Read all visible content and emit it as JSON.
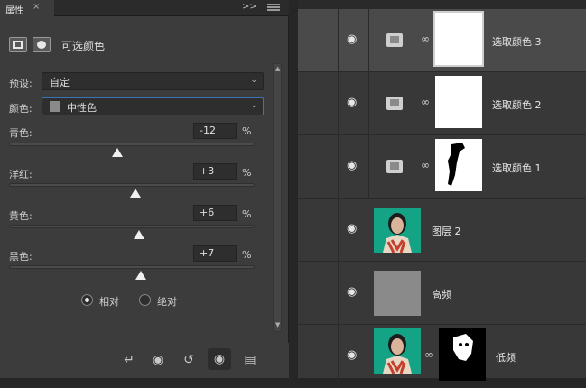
{
  "properties": {
    "tab_title": "属性",
    "tab_close": "×",
    "collapse": ">>",
    "header_title": "可选颜色",
    "preset_label": "预设:",
    "preset_value": "自定",
    "colors_label": "颜色:",
    "colors_value": "中性色",
    "sliders": [
      {
        "label": "青色:",
        "value": "-12",
        "unit": "%",
        "level": -12
      },
      {
        "label": "洋红:",
        "value": "+3",
        "unit": "%",
        "level": 3
      },
      {
        "label": "黄色:",
        "value": "+6",
        "unit": "%",
        "level": 6
      },
      {
        "label": "黑色:",
        "value": "+7",
        "unit": "%",
        "level": 7
      }
    ],
    "method": {
      "relative": "相对",
      "absolute": "绝对",
      "selected": "relative"
    }
  },
  "layers": [
    {
      "name": "选取颜色 3",
      "kind": "adjustment",
      "selected": true
    },
    {
      "name": "选取颜色 2",
      "kind": "adjustment",
      "selected": false
    },
    {
      "name": "选取颜色 1",
      "kind": "adjustment",
      "selected": false
    },
    {
      "name": "图层 2",
      "kind": "image",
      "selected": false
    },
    {
      "name": "高频",
      "kind": "gray",
      "selected": false
    },
    {
      "name": "低频",
      "kind": "image-mask",
      "selected": false
    }
  ],
  "icons": {
    "eye": "eye-icon",
    "chain": "link-icon",
    "clip": "clip-to-layer-icon",
    "prev": "previous-state-icon",
    "reset": "reset-icon",
    "delete": "trash-icon"
  }
}
